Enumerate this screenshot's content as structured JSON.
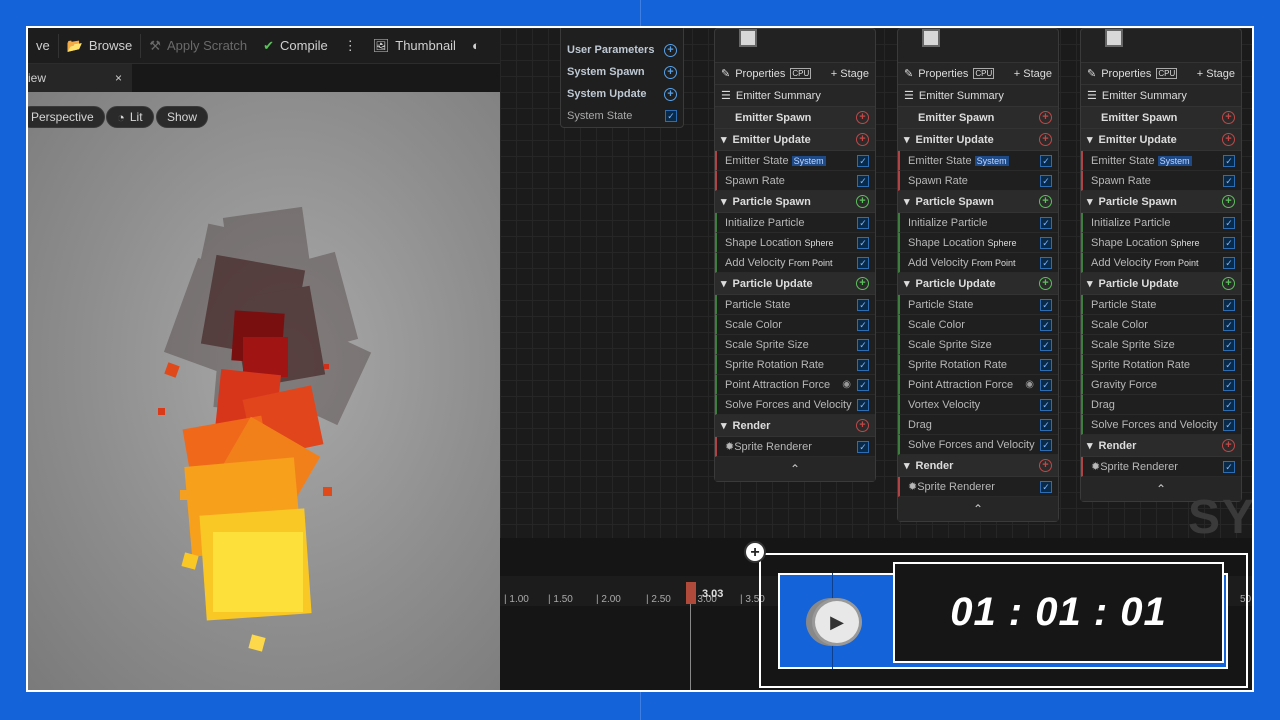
{
  "toolbar": {
    "save_label": "ve",
    "browse_label": "Browse",
    "apply_scratch_label": "Apply Scratch",
    "compile_label": "Compile",
    "thumbnail_label": "Thumbnail"
  },
  "viewport": {
    "tab_label": "iew",
    "tab_close": "×",
    "perspective_label": "Perspective",
    "lit_label": "Lit",
    "show_label": "Show"
  },
  "system_node": {
    "rows": [
      {
        "label": "User Parameters",
        "kind": "plus"
      },
      {
        "label": "System Spawn",
        "kind": "plus"
      },
      {
        "label": "System Update",
        "kind": "plus"
      },
      {
        "label": "System State",
        "kind": "check"
      }
    ]
  },
  "emitters": [
    {
      "properties": "Properties",
      "cpu": "CPU",
      "stage": "Stage",
      "summary": "Emitter Summary",
      "sections": [
        {
          "title": "Emitter Spawn",
          "accent": "red",
          "modules": []
        },
        {
          "title": "Emitter Update",
          "accent": "red",
          "modules": [
            {
              "label": "Emitter State",
              "tag": "System",
              "tagtype": "sys"
            },
            {
              "label": "Spawn Rate"
            }
          ]
        },
        {
          "title": "Particle Spawn",
          "accent": "green",
          "modules": [
            {
              "label": "Initialize Particle"
            },
            {
              "label": "Shape Location",
              "tag": "Sphere"
            },
            {
              "label": "Add Velocity",
              "tag": "From Point"
            }
          ]
        },
        {
          "title": "Particle Update",
          "accent": "green",
          "modules": [
            {
              "label": "Particle State"
            },
            {
              "label": "Scale Color"
            },
            {
              "label": "Scale Sprite Size"
            },
            {
              "label": "Sprite Rotation Rate"
            },
            {
              "label": "Point Attraction Force",
              "eye": true
            },
            {
              "label": "Solve Forces and Velocity"
            }
          ]
        },
        {
          "title": "Render",
          "accent": "red",
          "modules": [
            {
              "label": "Sprite Renderer",
              "icon": true
            }
          ]
        }
      ]
    },
    {
      "properties": "Properties",
      "cpu": "CPU",
      "stage": "Stage",
      "summary": "Emitter Summary",
      "sections": [
        {
          "title": "Emitter Spawn",
          "accent": "red",
          "modules": []
        },
        {
          "title": "Emitter Update",
          "accent": "red",
          "modules": [
            {
              "label": "Emitter State",
              "tag": "System",
              "tagtype": "sys"
            },
            {
              "label": "Spawn Rate"
            }
          ]
        },
        {
          "title": "Particle Spawn",
          "accent": "green",
          "modules": [
            {
              "label": "Initialize Particle"
            },
            {
              "label": "Shape Location",
              "tag": "Sphere"
            },
            {
              "label": "Add Velocity",
              "tag": "From Point"
            }
          ]
        },
        {
          "title": "Particle Update",
          "accent": "green",
          "modules": [
            {
              "label": "Particle State"
            },
            {
              "label": "Scale Color"
            },
            {
              "label": "Scale Sprite Size"
            },
            {
              "label": "Sprite Rotation Rate"
            },
            {
              "label": "Point Attraction Force",
              "eye": true
            },
            {
              "label": "Vortex Velocity"
            },
            {
              "label": "Drag"
            },
            {
              "label": "Solve Forces and Velocity"
            }
          ]
        },
        {
          "title": "Render",
          "accent": "red",
          "modules": [
            {
              "label": "Sprite Renderer",
              "icon": true
            }
          ]
        }
      ]
    },
    {
      "properties": "Properties",
      "cpu": "CPU",
      "stage": "Stage",
      "summary": "Emitter Summary",
      "sections": [
        {
          "title": "Emitter Spawn",
          "accent": "red",
          "modules": []
        },
        {
          "title": "Emitter Update",
          "accent": "red",
          "modules": [
            {
              "label": "Emitter State",
              "tag": "System",
              "tagtype": "sys"
            },
            {
              "label": "Spawn Rate"
            }
          ]
        },
        {
          "title": "Particle Spawn",
          "accent": "green",
          "modules": [
            {
              "label": "Initialize Particle"
            },
            {
              "label": "Shape Location",
              "tag": "Sphere"
            },
            {
              "label": "Add Velocity",
              "tag": "From Point"
            }
          ]
        },
        {
          "title": "Particle Update",
          "accent": "green",
          "modules": [
            {
              "label": "Particle State"
            },
            {
              "label": "Scale Color"
            },
            {
              "label": "Scale Sprite Size"
            },
            {
              "label": "Sprite Rotation Rate"
            },
            {
              "label": "Gravity Force"
            },
            {
              "label": "Drag"
            },
            {
              "label": "Solve Forces and Velocity"
            }
          ]
        },
        {
          "title": "Render",
          "accent": "red",
          "modules": [
            {
              "label": "Sprite Renderer",
              "icon": true
            }
          ]
        }
      ]
    }
  ],
  "watermark": "SYS",
  "timeline": {
    "ticks": [
      "1.00",
      "1.50",
      "2.00",
      "2.50",
      "3.00",
      "3.50"
    ],
    "tick_end": "50",
    "playhead_label": "3.03"
  },
  "overlay": {
    "timer": "01 : 01 : 01"
  },
  "colors": {
    "background_blue": "#1463d8",
    "section_red": "#c04848",
    "section_green": "#5cc05c",
    "check_blue": "#2d6db4"
  }
}
